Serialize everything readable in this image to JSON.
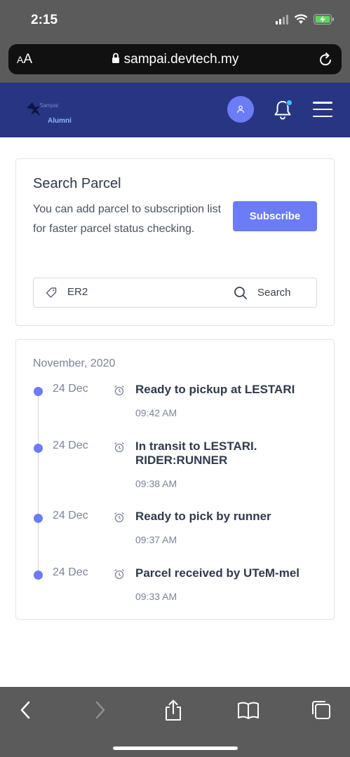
{
  "status_bar": {
    "time": "2:15"
  },
  "browser": {
    "aa_label_big": "A",
    "aa_label_small": "A",
    "url": "sampai.devtech.my"
  },
  "header": {
    "logo_text": "Sampai",
    "logo_subtitle": "Alumni"
  },
  "search_card": {
    "title": "Search Parcel",
    "description": "You can add parcel to subscription list for faster parcel status checking.",
    "subscribe_label": "Subscribe",
    "search_value": "ER2",
    "search_label": "Search"
  },
  "timeline": {
    "month": "November, 2020",
    "items": [
      {
        "date": "24 Dec",
        "title": "Ready to pickup at LESTARI",
        "time": "09:42 AM"
      },
      {
        "date": "24 Dec",
        "title": "In transit to LESTARI. RIDER:RUNNER",
        "time": "09:38 AM"
      },
      {
        "date": "24 Dec",
        "title": "Ready to pick by runner",
        "time": "09:37 AM"
      },
      {
        "date": "24 Dec",
        "title": "Parcel received by UTeM-mel",
        "time": "09:33 AM"
      }
    ]
  },
  "colors": {
    "brand": "#283583",
    "accent": "#6b7cf6",
    "notification_dot": "#3dc4ff"
  },
  "icons": [
    "back-icon",
    "forward-icon",
    "share-icon",
    "bookmarks-icon",
    "tabs-icon"
  ]
}
